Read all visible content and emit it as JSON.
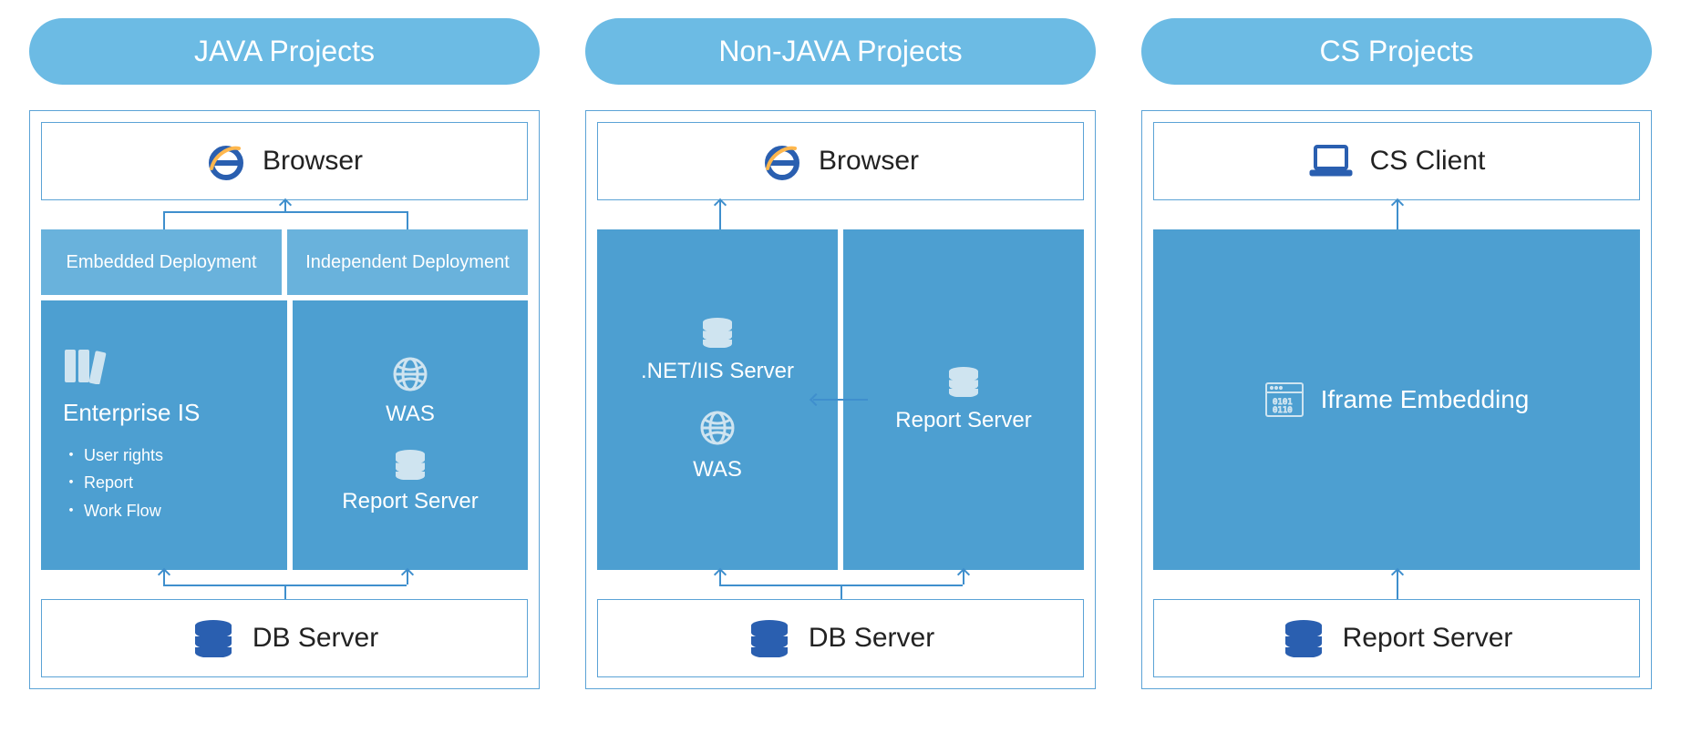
{
  "columns": {
    "java": {
      "title": "JAVA Projects",
      "top_box": "Browser",
      "deploy_left": "Embedded Deployment",
      "deploy_right": "Independent Deployment",
      "enterprise_title": "Enterprise IS",
      "enterprise_items": {
        "a": "User rights",
        "b": "Report",
        "c": "Work Flow"
      },
      "was_label": "WAS",
      "report_server_label": "Report Server",
      "bottom_box": "DB Server"
    },
    "nonjava": {
      "title": "Non-JAVA Projects",
      "top_box": "Browser",
      "netiis_label": ".NET/IIS Server",
      "was_label": "WAS",
      "report_server_label": "Report Server",
      "bottom_box": "DB Server"
    },
    "cs": {
      "title": "CS Projects",
      "top_box": "CS Client",
      "iframe_label": "Iframe Embedding",
      "bottom_box": "Report Server"
    }
  }
}
